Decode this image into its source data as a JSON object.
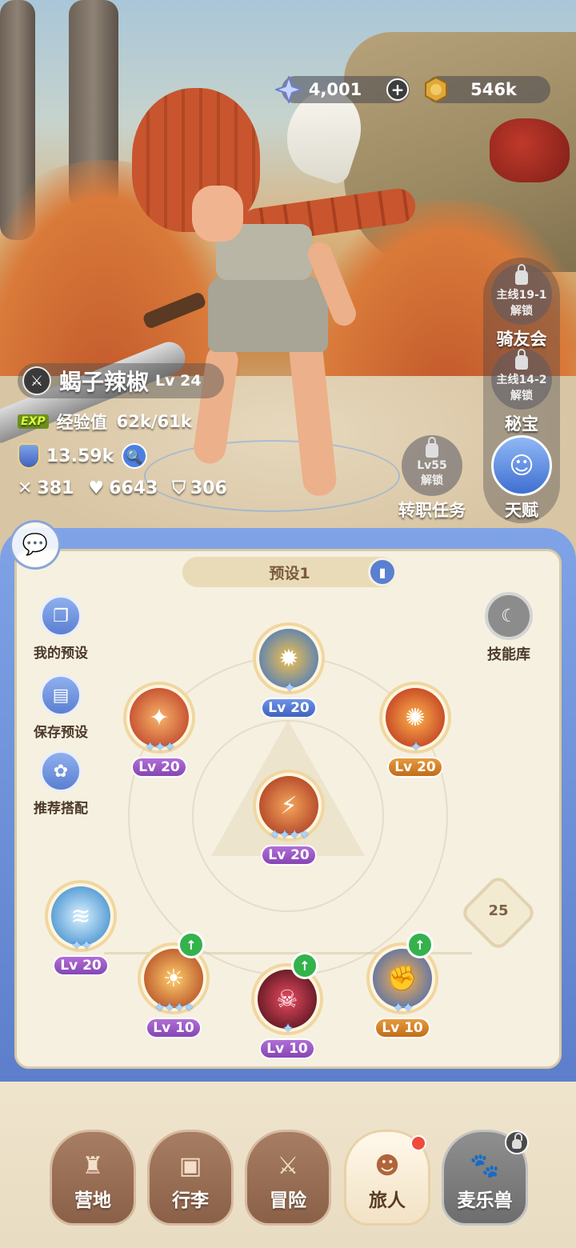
{
  "currency": {
    "gems": "4,001",
    "gold": "546k",
    "gem_icon": "star-crystal-icon",
    "gold_icon": "coin-icon",
    "add_icon": "plus-icon"
  },
  "player": {
    "name": "蝎子辣椒",
    "level": "Lv 24",
    "exp_tag": "EXP",
    "exp_label": "经验值",
    "exp_value": "62k/61k",
    "power": "13.59k",
    "attack": "381",
    "hp": "6643",
    "defense": "306"
  },
  "side_buttons": {
    "knight": {
      "req": "主线19-1",
      "state": "解锁",
      "label": "骑友会"
    },
    "treasure": {
      "req": "主线14-2",
      "state": "解锁",
      "label": "秘宝"
    },
    "job": {
      "req": "Lv55",
      "state": "解锁",
      "label": "转职任务"
    },
    "talent": {
      "label": "天赋"
    }
  },
  "panel": {
    "preset_tab": "预设1",
    "left_buttons": [
      {
        "label": "我的预设",
        "icon": "cards-icon"
      },
      {
        "label": "保存预设",
        "icon": "save-icon"
      },
      {
        "label": "推荐搭配",
        "icon": "combo-icon"
      }
    ],
    "skill_library": "技能库",
    "node_number": "25",
    "skills": [
      {
        "id": "top",
        "level": "Lv 20",
        "stars": "✦",
        "color": "blue"
      },
      {
        "id": "left",
        "level": "Lv 20",
        "stars": "✦✦✦",
        "color": "purple"
      },
      {
        "id": "right",
        "level": "Lv 20",
        "stars": "✦",
        "color": "orange"
      },
      {
        "id": "center",
        "level": "Lv 20",
        "stars": "✦✦✦✦",
        "color": "purple"
      },
      {
        "id": "bottom-1",
        "level": "Lv 20",
        "stars": "✦✦",
        "color": "purple"
      },
      {
        "id": "bottom-2",
        "level": "Lv 10",
        "stars": "✦✦✦✦",
        "color": "purple"
      },
      {
        "id": "bottom-3",
        "level": "Lv 10",
        "stars": "✦",
        "color": "purple"
      },
      {
        "id": "bottom-4",
        "level": "Lv 10",
        "stars": "✦✦",
        "color": "orange"
      }
    ]
  },
  "nav": [
    {
      "label": "营地",
      "icon": "castle-icon"
    },
    {
      "label": "行李",
      "icon": "backpack-icon"
    },
    {
      "label": "冒险",
      "icon": "crossed-swords-icon"
    },
    {
      "label": "旅人",
      "icon": "traveler-icon"
    },
    {
      "label": "麦乐兽",
      "icon": "pet-icon"
    }
  ],
  "colors": {
    "panel_blue": "#5d7fcb",
    "panel_bg": "#f6f0e1",
    "lv_blue": "#3f62c0",
    "lv_purple": "#8645b3",
    "lv_orange": "#c16d19",
    "upgrade_green": "#34b24c"
  }
}
